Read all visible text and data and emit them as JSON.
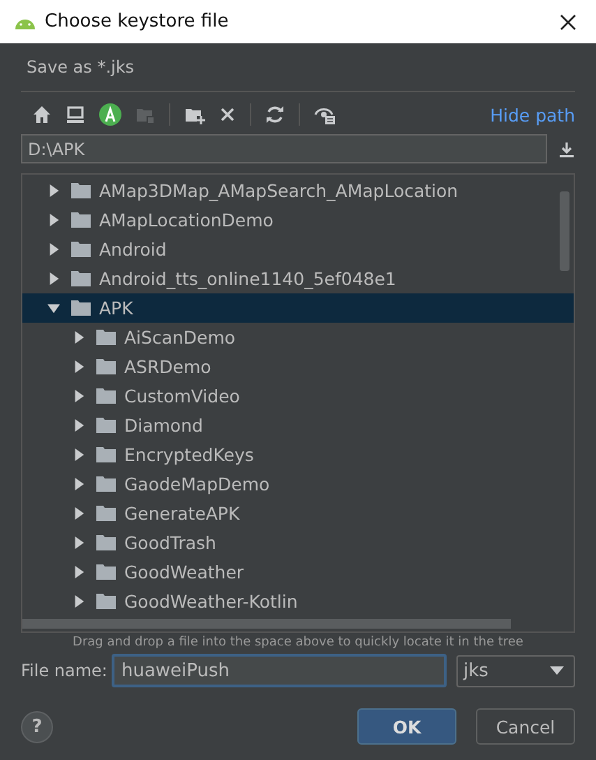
{
  "window": {
    "title": "Choose keystore file"
  },
  "description": "Save as *.jks",
  "toolbar": {
    "buttons": [
      {
        "kind": "home",
        "disabled": false
      },
      {
        "kind": "desktop",
        "disabled": false
      },
      {
        "kind": "android",
        "disabled": false
      },
      {
        "kind": "module",
        "disabled": true
      },
      {
        "kind": "new-folder",
        "disabled": false
      },
      {
        "kind": "delete",
        "disabled": false
      },
      {
        "kind": "refresh",
        "disabled": false
      },
      {
        "kind": "hidden",
        "disabled": false
      }
    ],
    "hide_path": "Hide path"
  },
  "path": {
    "value": "D:\\APK"
  },
  "tree": [
    {
      "label": "AMap3DMap_AMapSearch_AMapLocation",
      "expanded": false,
      "selected": false
    },
    {
      "label": "AMapLocationDemo",
      "expanded": false,
      "selected": false
    },
    {
      "label": "Android",
      "expanded": false,
      "selected": false
    },
    {
      "label": "Android_tts_online1140_5ef048e1",
      "expanded": false,
      "selected": false
    },
    {
      "label": "APK",
      "expanded": true,
      "selected": true,
      "children": [
        {
          "label": "AiScanDemo",
          "expanded": false,
          "selected": false
        },
        {
          "label": "ASRDemo",
          "expanded": false,
          "selected": false
        },
        {
          "label": "CustomVideo",
          "expanded": false,
          "selected": false
        },
        {
          "label": "Diamond",
          "expanded": false,
          "selected": false
        },
        {
          "label": "EncryptedKeys",
          "expanded": false,
          "selected": false
        },
        {
          "label": "GaodeMapDemo",
          "expanded": false,
          "selected": false
        },
        {
          "label": "GenerateAPK",
          "expanded": false,
          "selected": false
        },
        {
          "label": "GoodTrash",
          "expanded": false,
          "selected": false
        },
        {
          "label": "GoodWeather",
          "expanded": false,
          "selected": false
        },
        {
          "label": "GoodWeather-Kotlin",
          "expanded": false,
          "selected": false
        }
      ]
    }
  ],
  "hint": "Drag and drop a file into the space above to quickly locate it in the tree",
  "file_name": {
    "label": "File name:",
    "value": "huaweiPush"
  },
  "file_type": {
    "value": "jks"
  },
  "help": "?",
  "buttons": [
    {
      "label": "OK",
      "kind": "primary"
    },
    {
      "label": "Cancel",
      "kind": "secondary"
    }
  ]
}
